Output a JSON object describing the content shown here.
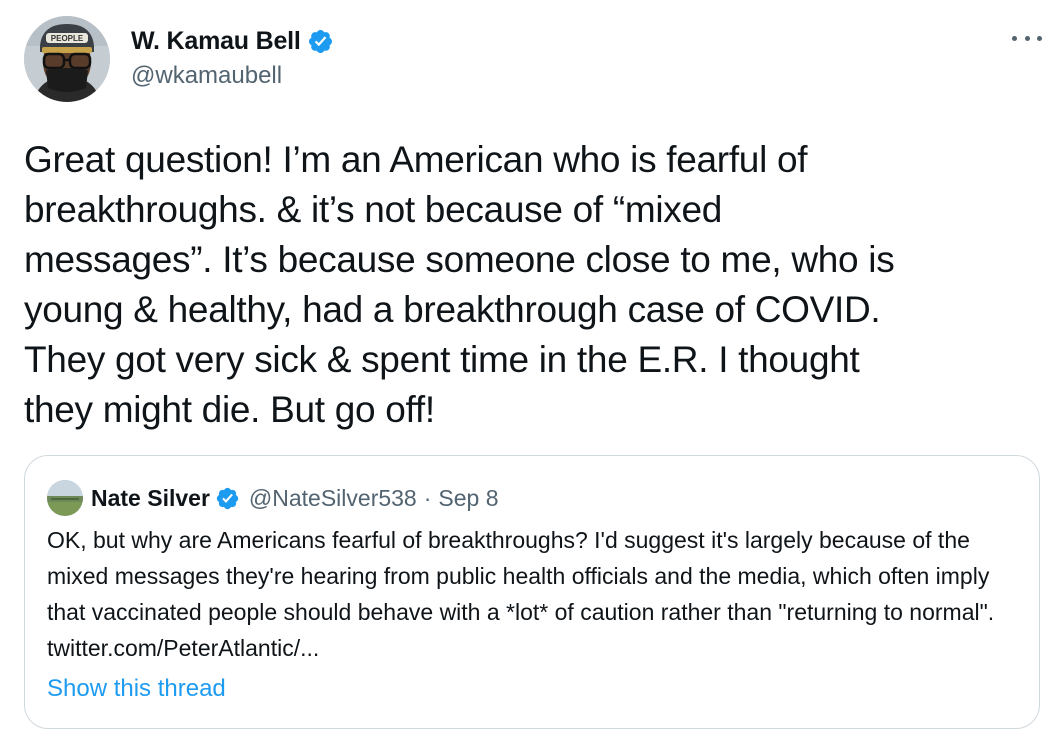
{
  "author": {
    "display_name": "W. Kamau Bell",
    "handle": "@wkamaubell",
    "verified": true
  },
  "tweet": {
    "text": "Great question! I’m an American who is fearful of\nbreakthroughs. & it’s not because of “mixed\nmessages”. It’s because someone close to me, who is\nyoung & healthy, had a breakthrough case of COVID.\nThey got very sick & spent time in the E.R. I thought\nthey might die. But go off!"
  },
  "quoted_tweet": {
    "display_name": "Nate Silver",
    "handle": "@NateSilver538",
    "separator": "·",
    "date": "Sep 8",
    "verified": true,
    "text": "OK, but why are Americans fearful of breakthroughs? I'd suggest it's largely because of the mixed messages they're hearing from public health officials and the media, which often imply that vaccinated people should behave with a *lot* of caution rather than \"returning to normal\". twitter.com/PeterAtlantic/...",
    "show_thread_label": "Show this thread"
  },
  "icons": {
    "verified": "verified-badge-icon",
    "more": "more-options-icon"
  },
  "colors": {
    "verified_blue": "#1d9bf0",
    "link_blue": "#1d9bf0",
    "secondary_text": "#536471",
    "border": "#cfd9de"
  }
}
